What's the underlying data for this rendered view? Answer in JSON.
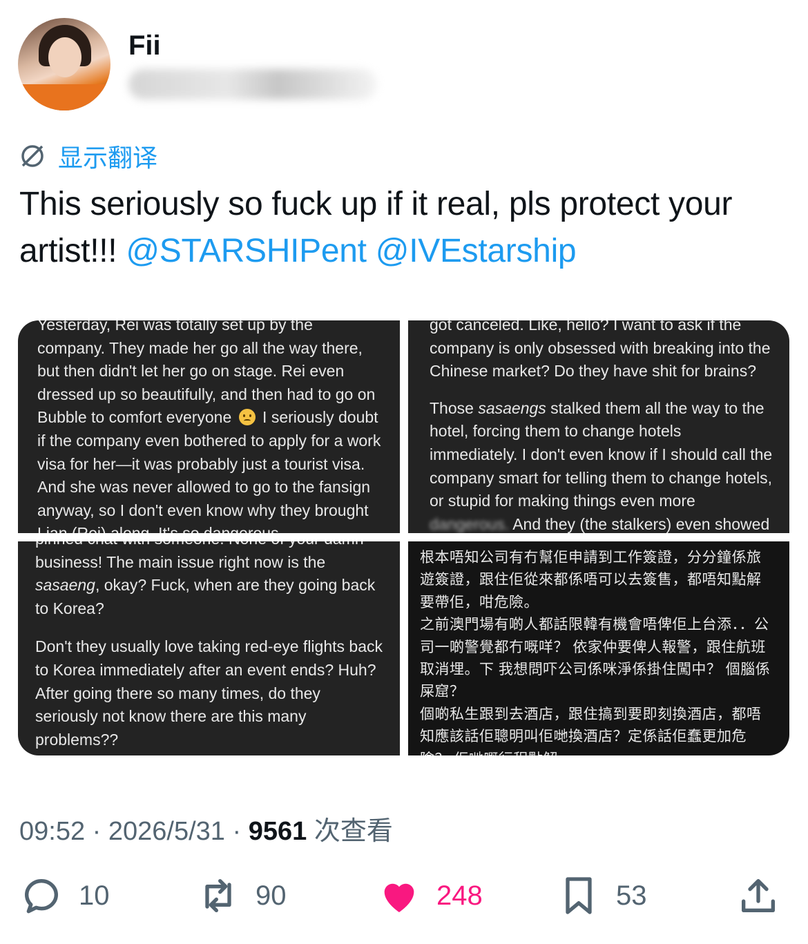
{
  "author": {
    "name": "Fii"
  },
  "translate_label": "显示翻译",
  "tweet": {
    "text": "This seriously so fuck up if it real, pls protect your artist!!! ",
    "mentions": [
      "@STARSHIPent",
      "@IVEstarship"
    ]
  },
  "media": {
    "panel1": {
      "lines_before_emoji": "Yesterday, Rei was totally set up by the company. They made her go all the way there, but then didn't let her go on stage. Rei even dressed up so beautifully, and then had to go on Bubble to comfort everyone",
      "lines_after_emoji": " I seriously doubt if the company even bothered to apply for a work visa for her—it was probably just a tourist visa. And she was never allowed to go to the fansign anyway, so I don't even know why they brought Lian (Rei) along. It's so dangerous."
    },
    "panel2": {
      "para1": "got canceled. Like, hello? I want to ask if the company is only obsessed with breaking into the Chinese market? Do they have shit for brains?",
      "para2_em": "sasaengs",
      "para2_pre": "Those ",
      "para2_post": " stalked them all the way to the hotel, forcing them to change hotels immediately. I don't even know if I should call the company smart for telling them to change hotels, or stupid for making things even more",
      "para2_blur": "dangerous.",
      "para2_end": " And they (the stalkers) even showed"
    },
    "panel3": {
      "line_cut": "pinned chat with someone. None of your damn",
      "para1_pre": "business! The main issue right now is the ",
      "para1_em": "sasaeng",
      "para1_post": ", okay? Fuck, when are they going back to Korea?",
      "para2": "Don't they usually love taking red-eye flights back to Korea immediately after an event ends? Huh? After going there so many times, do they seriously not know there are this many problems??"
    },
    "panel4": {
      "text": "根本唔知公司有冇幫佢申請到工作簽證，分分鐘係旅遊簽證，跟住佢從來都係唔可以去簽售，都唔知點解要帶佢，咁危險。\n之前澳門場有啲人都話限韓有機會唔俾佢上台添．．公司一啲警覺都冇嘅咩？ 依家仲要俾人報警，跟住航班取消埋。下 我想問吓公司係咪淨係掛住闖中？ 個腦係屎窟？\n個啲私生跟到去酒店，跟住搞到要即刻換酒店，都唔知應該話佢聰明叫佢哋換酒店？定係話佢蠢更加危險？ 佢哋嘅行程點解…"
    }
  },
  "meta": {
    "time": "09:52",
    "date": "2026/5/31",
    "views": "9561",
    "views_label": "次查看",
    "sep": "·"
  },
  "actions": {
    "replies": "10",
    "retweets": "90",
    "likes": "248",
    "bookmarks": "53"
  },
  "colors": {
    "link": "#1d9bf0",
    "like": "#f91880",
    "muted": "#536471"
  }
}
